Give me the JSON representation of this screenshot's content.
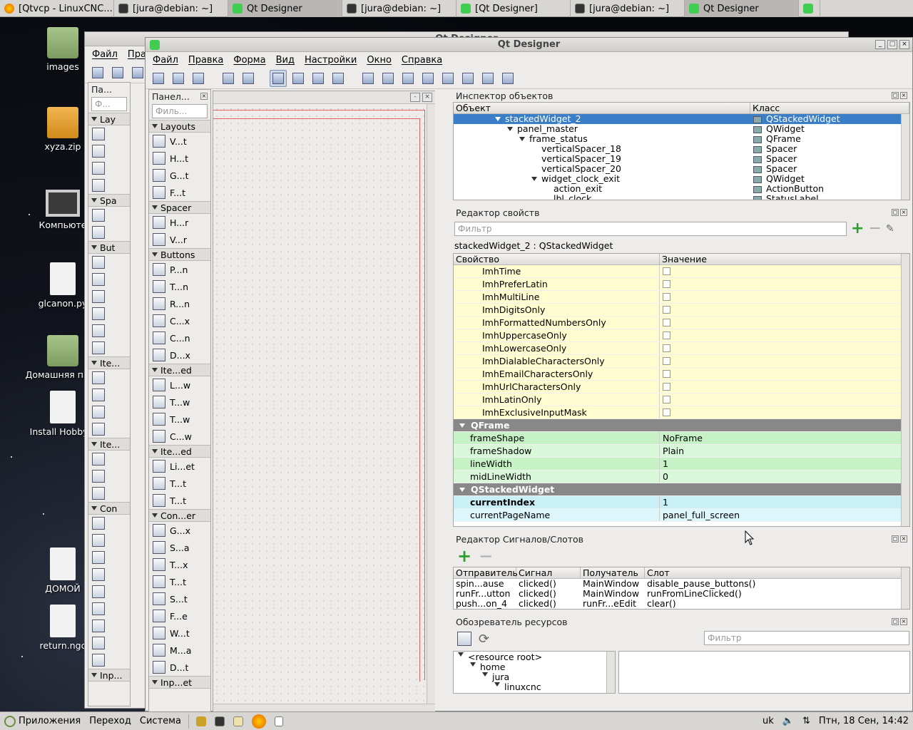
{
  "taskbar_top": {
    "tabs": [
      {
        "label": "[Qtvcp - LinuxCNC...",
        "icon": "firefox-icon"
      },
      {
        "label": "[jura@debian: ~]",
        "icon": "terminal-icon"
      },
      {
        "label": "Qt Designer",
        "icon": "qt-icon"
      },
      {
        "label": "[jura@debian: ~]",
        "icon": "terminal-icon"
      },
      {
        "label": "[Qt Designer]",
        "icon": "qt-icon"
      },
      {
        "label": "[jura@debian: ~]",
        "icon": "terminal-icon"
      },
      {
        "label": "Qt Designer",
        "icon": "qt-icon"
      }
    ]
  },
  "desktop": {
    "icons": [
      {
        "label": "images",
        "type": "folder-icon"
      },
      {
        "label": "xyza.zip",
        "type": "zip-icon"
      },
      {
        "label": "Компьюте",
        "type": "computer-icon"
      },
      {
        "label": "glcanon.py",
        "type": "file-icon"
      },
      {
        "label": "Домашняя папк",
        "type": "home-folder-icon"
      },
      {
        "label": "Install HobbyM",
        "type": "file-icon"
      },
      {
        "label": "ДОМОЙ",
        "type": "file-icon"
      },
      {
        "label": "return.ngc",
        "type": "file-icon"
      }
    ]
  },
  "back_window": {
    "title": "Qt Designer",
    "menu": [
      "Файл",
      "Пра"
    ],
    "panel_title": "Па...",
    "filter_placeholder": "Ф...",
    "categories": [
      "Lay",
      "Spa",
      "But",
      "Ite...",
      "Ite...",
      "Con",
      "Inp..."
    ]
  },
  "main_window": {
    "title": "Qt Designer",
    "menu": [
      "Файл",
      "Правка",
      "Форма",
      "Вид",
      "Настройки",
      "Окно",
      "Справка"
    ]
  },
  "widget_box": {
    "title": "Панел...",
    "filter_placeholder": "Филь...",
    "groups": [
      {
        "name": "Layouts",
        "items": [
          "V...t",
          "H...t",
          "G...t",
          "F...t"
        ]
      },
      {
        "name": "Spacer",
        "items": [
          "H...r",
          "V...r"
        ]
      },
      {
        "name": "Buttons",
        "items": [
          "P...n",
          "T...n",
          "R...n",
          "C...x",
          "C...n",
          "D...x"
        ]
      },
      {
        "name": "Ite...ed",
        "items": [
          "L...w",
          "T...w",
          "T...w",
          "C...w"
        ]
      },
      {
        "name": "Ite...ed",
        "items": [
          "Li...et",
          "T...t",
          "T...t"
        ]
      },
      {
        "name": "Con...er",
        "items": [
          "G...x",
          "S...a",
          "T...x",
          "T...t",
          "S...t",
          "F...e",
          "W...t",
          "M...a",
          "D...t"
        ]
      },
      {
        "name": "Inp...et",
        "items": []
      }
    ]
  },
  "object_inspector": {
    "title": "Инспектор объектов",
    "col_object": "Объект",
    "col_class": "Класс",
    "rows": [
      {
        "name": "stackedWidget_2",
        "class": "QStackedWidget",
        "indent": 0,
        "arrow": true,
        "selected": true
      },
      {
        "name": "panel_master",
        "class": "QWidget",
        "indent": 1,
        "arrow": true,
        "selected": false
      },
      {
        "name": "frame_status",
        "class": "QFrame",
        "indent": 2,
        "arrow": true,
        "selected": false
      },
      {
        "name": "verticalSpacer_18",
        "class": "Spacer",
        "indent": 3,
        "arrow": false,
        "selected": false
      },
      {
        "name": "verticalSpacer_19",
        "class": "Spacer",
        "indent": 3,
        "arrow": false,
        "selected": false
      },
      {
        "name": "verticalSpacer_20",
        "class": "Spacer",
        "indent": 3,
        "arrow": false,
        "selected": false
      },
      {
        "name": "widget_clock_exit",
        "class": "QWidget",
        "indent": 3,
        "arrow": true,
        "selected": false
      },
      {
        "name": "action_exit",
        "class": "ActionButton",
        "indent": 4,
        "arrow": false,
        "selected": false
      },
      {
        "name": "lbl_clock",
        "class": "StatusLabel",
        "indent": 4,
        "arrow": false,
        "selected": false
      }
    ]
  },
  "property_editor": {
    "title": "Редактор свойств",
    "filter_placeholder": "Фильтр",
    "context": "stackedWidget_2 : QStackedWidget",
    "col_property": "Свойство",
    "col_value": "Значение",
    "rows": [
      {
        "name": "ImhTime",
        "value": "",
        "kind": "check",
        "style": "yel",
        "indent": 2
      },
      {
        "name": "ImhPreferLatin",
        "value": "",
        "kind": "check",
        "style": "yel",
        "indent": 2
      },
      {
        "name": "ImhMultiLine",
        "value": "",
        "kind": "check",
        "style": "yel",
        "indent": 2
      },
      {
        "name": "ImhDigitsOnly",
        "value": "",
        "kind": "check",
        "style": "yel",
        "indent": 2
      },
      {
        "name": "ImhFormattedNumbersOnly",
        "value": "",
        "kind": "check",
        "style": "yel",
        "indent": 2
      },
      {
        "name": "ImhUppercaseOnly",
        "value": "",
        "kind": "check",
        "style": "yel",
        "indent": 2
      },
      {
        "name": "ImhLowercaseOnly",
        "value": "",
        "kind": "check",
        "style": "yel",
        "indent": 2
      },
      {
        "name": "ImhDialableCharactersOnly",
        "value": "",
        "kind": "check",
        "style": "yel",
        "indent": 2
      },
      {
        "name": "ImhEmailCharactersOnly",
        "value": "",
        "kind": "check",
        "style": "yel",
        "indent": 2
      },
      {
        "name": "ImhUrlCharactersOnly",
        "value": "",
        "kind": "check",
        "style": "yel",
        "indent": 2
      },
      {
        "name": "ImhLatinOnly",
        "value": "",
        "kind": "check",
        "style": "yel",
        "indent": 2
      },
      {
        "name": "ImhExclusiveInputMask",
        "value": "",
        "kind": "check",
        "style": "yel",
        "indent": 2
      },
      {
        "name": "QFrame",
        "value": "",
        "kind": "section",
        "style": "sect",
        "indent": 0
      },
      {
        "name": "frameShape",
        "value": "NoFrame",
        "kind": "text",
        "style": "grn",
        "indent": 1
      },
      {
        "name": "frameShadow",
        "value": "Plain",
        "kind": "text",
        "style": "grn2",
        "indent": 1
      },
      {
        "name": "lineWidth",
        "value": "1",
        "kind": "text",
        "style": "grn",
        "indent": 1
      },
      {
        "name": "midLineWidth",
        "value": "0",
        "kind": "text",
        "style": "grn2",
        "indent": 1
      },
      {
        "name": "QStackedWidget",
        "value": "",
        "kind": "section",
        "style": "sect",
        "indent": 0
      },
      {
        "name": "currentIndex",
        "value": "1",
        "kind": "bold",
        "style": "cyn",
        "indent": 1
      },
      {
        "name": "currentPageName",
        "value": "panel_full_screen",
        "kind": "text",
        "style": "cyn2",
        "indent": 1
      }
    ]
  },
  "signal_slot_editor": {
    "title": "Редактор Сигналов/Слотов",
    "columns": [
      "Отправитель",
      "Сигнал",
      "Получатель",
      "Слот"
    ],
    "rows": [
      [
        "spin...ause",
        "clicked()",
        "MainWindow",
        "disable_pause_buttons()"
      ],
      [
        "runFr...utton",
        "clicked()",
        "MainWindow",
        "runFromLineClicked()"
      ],
      [
        "push...on_4",
        "clicked()",
        "runFr...eEdit",
        "clear()"
      ]
    ]
  },
  "resource_browser": {
    "title": "Обозреватель ресурсов",
    "filter_placeholder": "Фильтр",
    "tree": [
      {
        "label": "<resource root>",
        "indent": 0
      },
      {
        "label": "home",
        "indent": 1
      },
      {
        "label": "jura",
        "indent": 2
      },
      {
        "label": "linuxcnc",
        "indent": 3
      }
    ]
  },
  "taskbar_bottom": {
    "menu": [
      "Приложения",
      "Переход",
      "Система"
    ],
    "layout": "uk",
    "clock": "Птн, 18 Сен, 14:42"
  },
  "colors": {
    "selection": "#3a7ec7",
    "qt_green": "#41cd52",
    "section_gray": "#888888"
  }
}
